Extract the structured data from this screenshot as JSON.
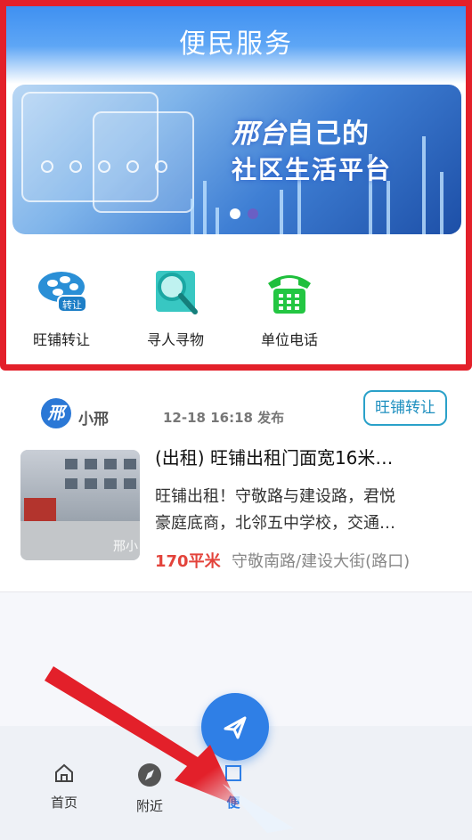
{
  "header": {
    "title": "便民服务"
  },
  "banner": {
    "brand": "邢台",
    "slogan_line1_suffix": "自己的",
    "slogan_line2": "社区生活平台",
    "pager": {
      "total": 2,
      "active": 0
    }
  },
  "services": [
    {
      "label": "旺铺转让",
      "icon": "shop-transfer-icon",
      "badge": "转让"
    },
    {
      "label": "寻人寻物",
      "icon": "search-magnifier-icon"
    },
    {
      "label": "单位电话",
      "icon": "telephone-icon"
    }
  ],
  "post": {
    "avatar_text": "邢",
    "author": "小邢",
    "time": "12-18 16:18 发布",
    "category": "旺铺转让",
    "title": "(出租) 旺铺出租门面宽16米…",
    "desc_line1": "旺铺出租！守敬路与建设路，君悦",
    "desc_line2": "豪庭底商，北邻五中学校，交通…",
    "area": "170平米",
    "address": "守敬南路/建设大街(路口)",
    "thumb_watermark": "邢小"
  },
  "tabbar": [
    {
      "label": "首页",
      "icon": "home-icon"
    },
    {
      "label": "附近",
      "icon": "compass-icon"
    },
    {
      "label": "便",
      "icon": "service-icon"
    }
  ],
  "colors": {
    "accent": "#2f7fe6",
    "highlight": "#e3202a",
    "price": "#e3433b"
  }
}
